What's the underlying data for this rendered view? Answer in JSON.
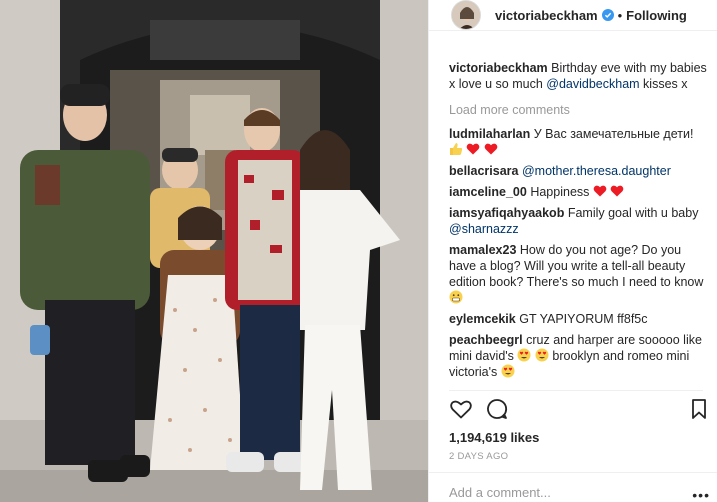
{
  "header": {
    "username": "victoriabeckham",
    "separator": "•",
    "follow_status": "Following"
  },
  "caption": {
    "username": "victoriabeckham",
    "text_before": "Birthday eve with my babies x love u so much ",
    "mention": "@davidbeckham",
    "text_after": " kisses x"
  },
  "load_more": "Load more comments",
  "comments": [
    {
      "username": "ludmilaharlan",
      "text": "У Вас замечательные дети!",
      "emojis": [
        "thumbs-up",
        "heart",
        "heart"
      ]
    },
    {
      "username": "bellacrisara",
      "mention": "@mother.theresa.daughter"
    },
    {
      "username": "iamceline_00",
      "text": "Happiness",
      "emojis": [
        "heart",
        "heart"
      ]
    },
    {
      "username": "iamsyafiqahyaakob",
      "text": "Family goal with u baby ",
      "mention": "@sharnazzz"
    },
    {
      "username": "mamalex23",
      "text": "How do you not age? Do you have a blog? Will you write a tell-all beauty edition book? There's so much I need to know",
      "emojis": [
        "grimace"
      ]
    },
    {
      "username": "eylemcekik",
      "text": "GT YAPIYORUM ff8f5c"
    },
    {
      "username": "peachbeegrl",
      "text": "cruz and harper are sooooo like mini david's",
      "text2": " brooklyn and romeo mini victoria's",
      "emojis": [
        "heart-eyes",
        "heart-eyes"
      ],
      "emojis2": [
        "heart-eyes"
      ]
    }
  ],
  "icons": {
    "like": "heart-outline-icon",
    "comment": "speech-bubble-icon",
    "save": "bookmark-icon",
    "verified": "verified-badge-icon",
    "more": "ellipsis-icon"
  },
  "likes": "1,194,619 likes",
  "timestamp": "2 DAYS AGO",
  "add_comment": {
    "placeholder": "Add a comment...",
    "more_label": "•••"
  },
  "colors": {
    "verified_blue": "#3897f0",
    "heart_red": "#ed1c24",
    "mention_blue": "#003569",
    "muted_gray": "#999999"
  }
}
